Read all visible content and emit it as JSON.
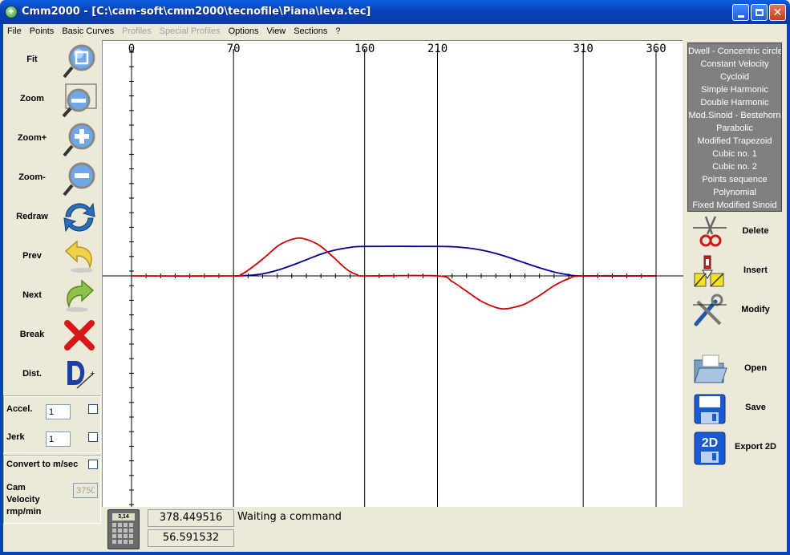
{
  "window": {
    "title": "Cmm2000 - [C:\\cam-soft\\cmm2000\\tecnofile\\Piana\\leva.tec]",
    "app_icon": "cam-app-icon"
  },
  "menu": [
    {
      "label": "File",
      "enabled": true
    },
    {
      "label": "Points",
      "enabled": true
    },
    {
      "label": "Basic Curves",
      "enabled": true
    },
    {
      "label": "Profiles",
      "enabled": false
    },
    {
      "label": "Special Profiles",
      "enabled": false
    },
    {
      "label": "Options",
      "enabled": true
    },
    {
      "label": "View",
      "enabled": true
    },
    {
      "label": "Sections",
      "enabled": true
    },
    {
      "label": "?",
      "enabled": true
    }
  ],
  "left_tools": [
    {
      "label": "Fit",
      "icon": "fit-magnifier-icon"
    },
    {
      "label": "Zoom",
      "icon": "zoom-window-icon"
    },
    {
      "label": "Zoom+",
      "icon": "zoom-in-icon"
    },
    {
      "label": "Zoom-",
      "icon": "zoom-out-icon"
    },
    {
      "label": "Redraw",
      "icon": "redraw-arrows-icon"
    },
    {
      "label": "Prev",
      "icon": "undo-arrow-icon"
    },
    {
      "label": "Next",
      "icon": "redo-arrow-icon"
    },
    {
      "label": "Break",
      "icon": "red-x-icon"
    },
    {
      "label": "Dist.",
      "icon": "distance-d-icon"
    }
  ],
  "params": {
    "accel_label": "Accel.",
    "accel_value": "1",
    "jerk_label": "Jerk",
    "jerk_value": "1",
    "convert_label": "Convert to m/sec",
    "cam_velocity_label_1": "Cam",
    "cam_velocity_label_2": "Velocity",
    "cam_velocity_label_3": "rmp/min",
    "cam_velocity_value": "3750"
  },
  "curve_types": [
    "Dwell - Concentric circle",
    "Constant Velocity",
    "Cycloid",
    "Simple Harmonic",
    "Double Harmonic",
    "Mod.Sinoid - Bestehorn",
    "Parabolic",
    "Modified Trapezoid",
    "Cubic no.  1",
    "Cubic no.  2",
    "Points sequence",
    "Polynomial",
    "Fixed Modified Sinoid"
  ],
  "right_tools": [
    {
      "label": "Delete",
      "icon": "scissors-cut-icon"
    },
    {
      "label": "Insert",
      "icon": "insert-segment-icon"
    },
    {
      "label": "Modify",
      "icon": "tools-modify-icon"
    },
    {
      "label": "Open",
      "icon": "open-folder-icon"
    },
    {
      "label": "Save",
      "icon": "floppy-save-icon"
    },
    {
      "label": "Export 2D",
      "icon": "export-2d-icon"
    }
  ],
  "status": {
    "coord_x": "378.449516",
    "coord_y": "56.591532",
    "message": "Waiting a command",
    "calc_label": "3,14"
  },
  "chart_data": {
    "type": "line",
    "x_ticks": [
      "0",
      "70",
      "160",
      "210",
      "310",
      "360"
    ],
    "x_tick_values": [
      0,
      70,
      160,
      210,
      310,
      360
    ],
    "xlim": [
      0,
      360
    ],
    "grid": "vertical lines at section boundaries",
    "series": [
      {
        "color": "#0000a0",
        "x": [
          70,
          80,
          90,
          100,
          110,
          120,
          130,
          140,
          150,
          160,
          210,
          220,
          230,
          240,
          250,
          260,
          270,
          280,
          290,
          300,
          310,
          360
        ],
        "y": [
          0,
          0.3,
          1.5,
          4.0,
          7.5,
          11.5,
          15.5,
          18.5,
          20.3,
          21,
          21,
          20.8,
          20.0,
          18.4,
          16.0,
          12.8,
          9.2,
          5.8,
          2.8,
          0.8,
          0,
          0
        ]
      },
      {
        "color": "#d00000",
        "x": [
          0,
          70,
          75,
          80,
          90,
          100,
          105,
          110,
          115,
          120,
          125,
          130,
          140,
          145,
          150,
          155,
          160,
          210,
          220,
          230,
          240,
          250,
          255,
          260,
          270,
          280,
          290,
          300,
          310,
          360
        ],
        "y": [
          0,
          0,
          1,
          4,
          12,
          21,
          24,
          26,
          27,
          26,
          24,
          21,
          12,
          7,
          3,
          0.8,
          0,
          0,
          -4,
          -11,
          -18,
          -22.5,
          -23.5,
          -23,
          -20,
          -14,
          -7,
          -2,
          0,
          0
        ]
      }
    ]
  }
}
